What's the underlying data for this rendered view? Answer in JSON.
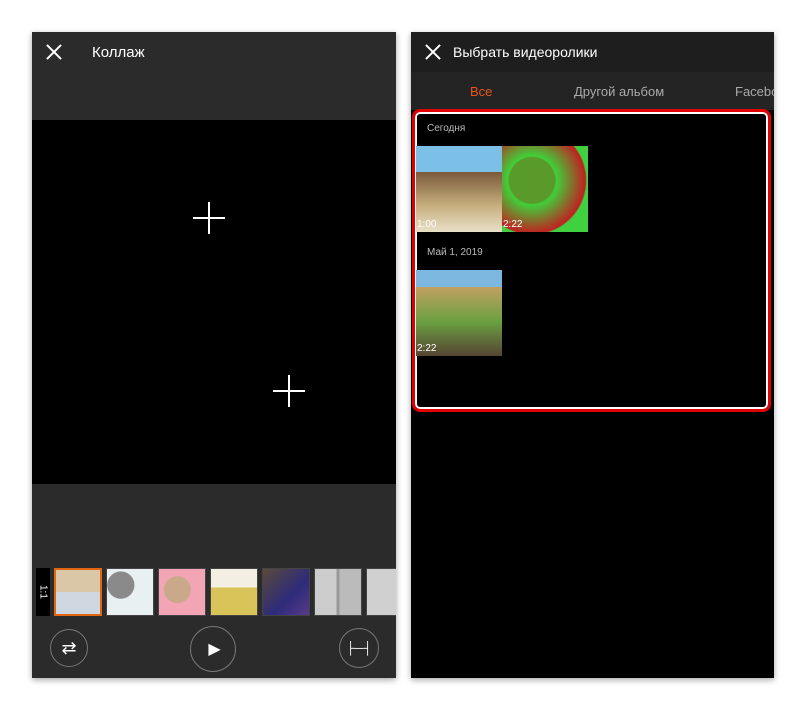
{
  "left": {
    "title": "Коллаж",
    "ratio": "1:1",
    "templates": [
      "template-1",
      "template-2",
      "template-3",
      "template-4",
      "template-5",
      "template-6",
      "template-7"
    ],
    "selected_template": 0,
    "accent": "#e0660f"
  },
  "right": {
    "title": "Выбрать видеоролики",
    "tabs": [
      {
        "label": "Все",
        "active": true
      },
      {
        "label": "Другой альбом"
      },
      {
        "label": "Facebook"
      }
    ],
    "accent": "#e8551c",
    "sections": [
      {
        "label": "Сегодня",
        "videos": [
          {
            "duration": "1:00"
          },
          {
            "duration": "2:22"
          }
        ]
      },
      {
        "label": "Май 1, 2019",
        "videos": [
          {
            "duration": "2:22"
          }
        ]
      }
    ],
    "highlight_color": "#e00000"
  }
}
